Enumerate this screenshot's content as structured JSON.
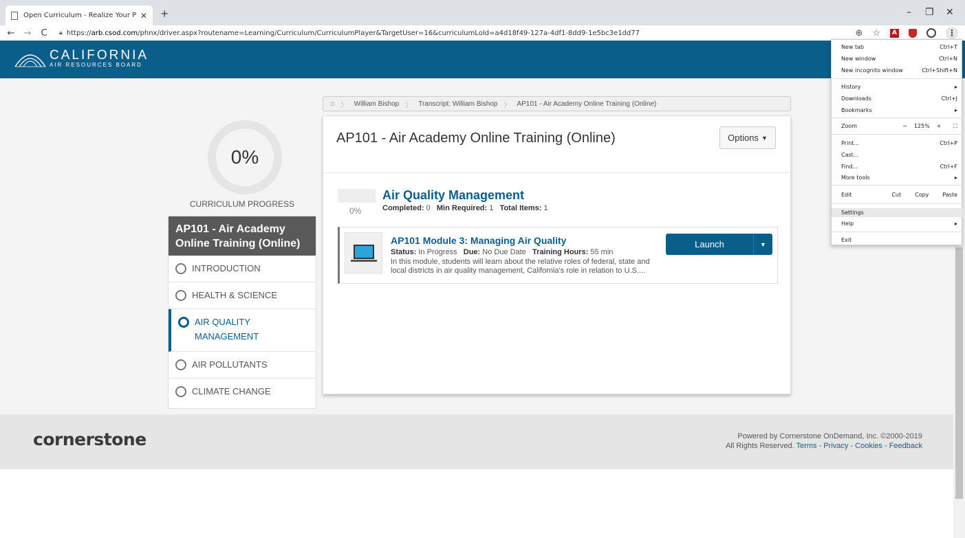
{
  "browser": {
    "tab_title": "Open Curriculum - Realize Your P",
    "url_prefix": "https://",
    "url_host": "arb.csod.com",
    "url_path": "/phnx/driver.aspx?routename=Learning/Curriculum/CurriculumPlayer&TargetUser=16&curriculumLoId=a4d18f49-127a-4df1-8dd9-1e5bc3e1dd77"
  },
  "menu": {
    "new_tab": "New tab",
    "new_tab_sc": "Ctrl+T",
    "new_window": "New window",
    "new_window_sc": "Ctrl+N",
    "incognito": "New incognito window",
    "incognito_sc": "Ctrl+Shift+N",
    "history": "History",
    "downloads": "Downloads",
    "downloads_sc": "Ctrl+J",
    "bookmarks": "Bookmarks",
    "zoom": "Zoom",
    "zoom_minus": "−",
    "zoom_value": "125%",
    "zoom_plus": "+",
    "print": "Print...",
    "print_sc": "Ctrl+P",
    "cast": "Cast...",
    "find": "Find...",
    "find_sc": "Ctrl+F",
    "more_tools": "More tools",
    "edit": "Edit",
    "cut": "Cut",
    "copy": "Copy",
    "paste": "Paste",
    "settings": "Settings",
    "help": "Help",
    "exit": "Exit"
  },
  "header": {
    "logo_main": "CALIFORNIA",
    "logo_sub": "AIR RESOURCES BOARD"
  },
  "progress": {
    "percent": "0%",
    "label": "CURRICULUM PROGRESS"
  },
  "sidebar": {
    "title": "AP101 - Air Academy Online Training (Online)",
    "sections": [
      {
        "label": "INTRODUCTION"
      },
      {
        "label": "HEALTH & SCIENCE"
      },
      {
        "label": "AIR QUALITY MANAGEMENT"
      },
      {
        "label": "AIR POLLUTANTS"
      },
      {
        "label": "CLIMATE CHANGE"
      }
    ]
  },
  "breadcrumb": {
    "items": [
      "William Bishop",
      "Transcript: William Bishop",
      "AP101 - Air Academy Online Training (Online)"
    ]
  },
  "main": {
    "title": "AP101 - Air Academy Online Training (Online)",
    "options_label": "Options",
    "section": {
      "percent": "0%",
      "title": "Air Quality Management",
      "completed_label": "Completed:",
      "completed_value": "0",
      "min_label": "Min Required:",
      "min_value": "1",
      "total_label": "Total Items:",
      "total_value": "1"
    },
    "item": {
      "title": "AP101 Module 3: Managing Air Quality",
      "status_label": "Status:",
      "status_value": "In Progress",
      "due_label": "Due:",
      "due_value": "No Due Date",
      "hours_label": "Training Hours:",
      "hours_value": "55 min",
      "description": "In this module, students will learn about the relative roles of federal, state and local districts in air quality management, California's role in relation to U.S....",
      "launch_label": "Launch"
    }
  },
  "footer": {
    "logo": "cornerstone",
    "powered": "Powered by Cornerstone OnDemand, Inc. ©2000-2019",
    "rights": "All Rights Reserved.",
    "links": [
      "Terms",
      "Privacy",
      "Cookies",
      "Feedback"
    ]
  },
  "colors": {
    "brand": "#0a5e8a",
    "sidebar_head": "#595959",
    "launch": "#0a5e8a"
  }
}
